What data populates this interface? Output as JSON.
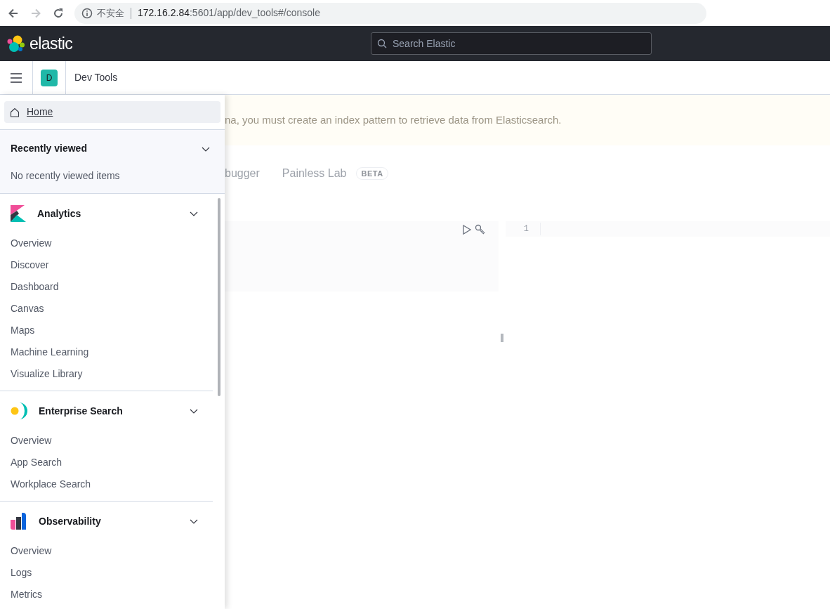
{
  "browser": {
    "security_label": "不安全",
    "url_host": "172.16.2.84",
    "url_path": ":5601/app/dev_tools#/console"
  },
  "header": {
    "brand": "elastic",
    "search": {
      "placeholder": "Search Elastic"
    }
  },
  "breadcrumb": {
    "space_initial": "D",
    "page": "Dev Tools"
  },
  "background": {
    "banner": "na, you must create an index pattern to retrieve data from Elasticsearch.",
    "tabs": [
      {
        "label": "bugger"
      },
      {
        "label": "Painless Lab",
        "badge": "BETA"
      }
    ],
    "editor": {
      "line_number": "1"
    }
  },
  "nav": {
    "home": {
      "label": "Home",
      "selected": true
    },
    "recent": {
      "title": "Recently viewed",
      "empty_text": "No recently viewed items",
      "expanded": true
    },
    "groups": [
      {
        "kind": "analytics",
        "title": "Analytics",
        "expanded": true,
        "items": [
          "Overview",
          "Discover",
          "Dashboard",
          "Canvas",
          "Maps",
          "Machine Learning",
          "Visualize Library"
        ]
      },
      {
        "kind": "enterprise",
        "title": "Enterprise Search",
        "expanded": true,
        "items": [
          "Overview",
          "App Search",
          "Workplace Search"
        ]
      },
      {
        "kind": "observability",
        "title": "Observability",
        "expanded": true,
        "items": [
          "Overview",
          "Logs",
          "Metrics"
        ]
      }
    ]
  }
}
